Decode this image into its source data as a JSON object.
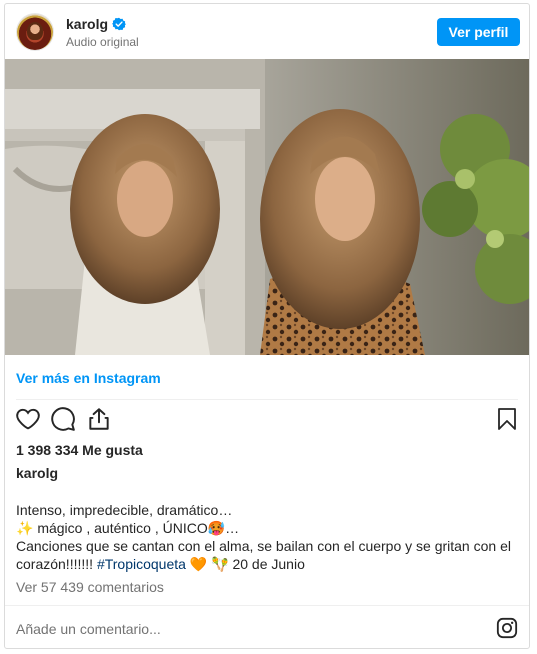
{
  "header": {
    "username": "karolg",
    "subtitle": "Audio original",
    "profile_button": "Ver perfil"
  },
  "media": {
    "description_icon": "video-still-image"
  },
  "links": {
    "view_more": "Ver más en Instagram"
  },
  "actions": {
    "icons": [
      "heart-icon",
      "comment-icon",
      "share-icon",
      "bookmark-icon"
    ]
  },
  "post": {
    "likes": "1 398 334 Me gusta",
    "owner": "karolg",
    "caption_line1": "Intenso, impredecible, dramático…",
    "caption_line2_emoji": "✨",
    "caption_line2_text": " mágico , auténtico , ÚNICO",
    "caption_line2_emoji2": "🥵",
    "caption_line2_end": "…",
    "caption_line3": "Canciones que se cantan con el alma, se bailan con el cuerpo y se gritan con el",
    "caption_line4_text": "corazón!!!!!!! ",
    "caption_line4_tag": "#Tropicoqueta",
    "caption_line4_emoji1": "🧡",
    "caption_line4_emoji2": "🪇",
    "caption_line4_date": "20 de Junio",
    "comments": "Ver 57 439 comentarios"
  },
  "comment_box": {
    "placeholder": "Añade un comentario..."
  },
  "colors": {
    "accent": "#0095f6",
    "muted": "#737373",
    "border": "#dbdbdb"
  }
}
